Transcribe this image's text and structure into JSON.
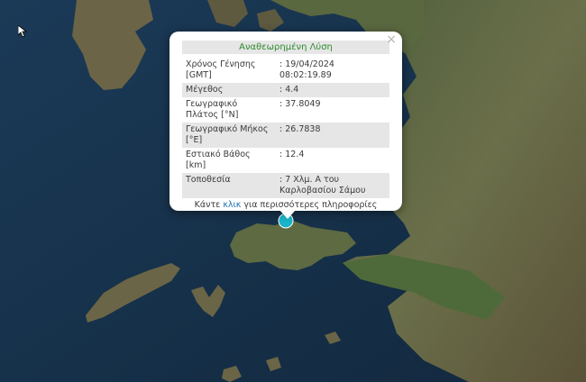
{
  "popup": {
    "title": "Αναθεωρημένη Λύση",
    "close_label": "×",
    "rows": [
      {
        "label": "Χρόνος Γένησης [GMT]",
        "value": ": 19/04/2024 08:02:19.89"
      },
      {
        "label": "Μέγεθος",
        "value": ": 4.4"
      },
      {
        "label": "Γεωγραφικό Πλάτος [°N]",
        "value": ": 37.8049"
      },
      {
        "label": "Γεωγραφικό Μήκος [°E]",
        "value": ": 26.7838"
      },
      {
        "label": "Εστιακό Βάθος [km]",
        "value": ": 12.4"
      },
      {
        "label": "Τοποθεσία",
        "value": ": 7 Χλμ. Α του Καρλοβασίου Σάμου"
      }
    ],
    "more_prefix": "Κάντε",
    "more_link": "κλικ",
    "more_suffix": "για περισσότερες πληροφορίες"
  },
  "marker": {
    "color": "#1ab3c8",
    "icon": "earthquake-marker"
  },
  "colors": {
    "sea": "#16304a",
    "land": "#5a6b45",
    "title_green": "#2e8b2e",
    "link_blue": "#1f6fb3"
  }
}
